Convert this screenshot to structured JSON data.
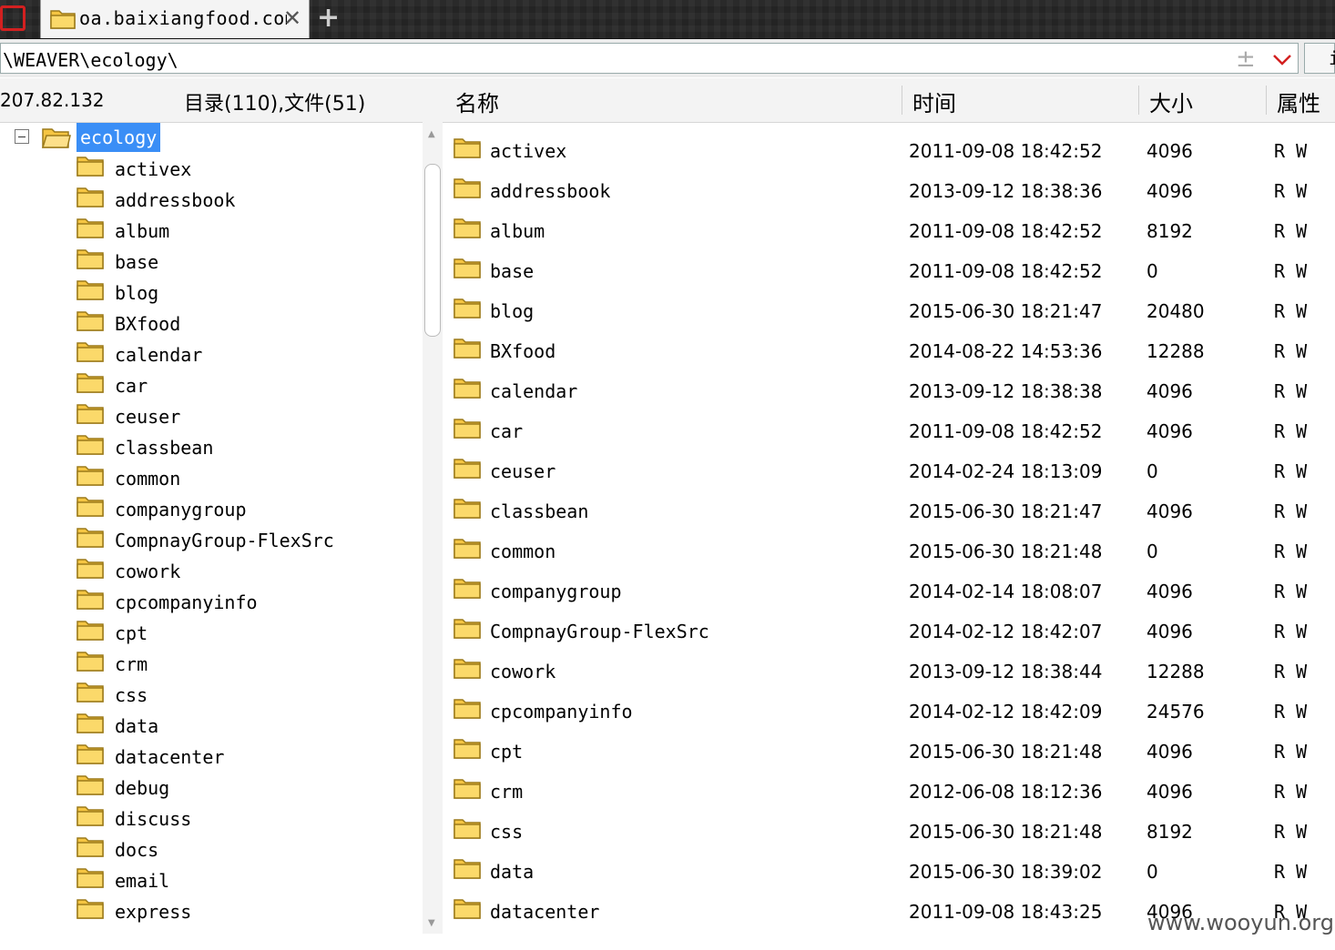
{
  "tab": {
    "title": "oa.baixiangfood.com"
  },
  "address": {
    "path": "\\WEAVER\\ecology\\",
    "go_label": "i"
  },
  "header": {
    "ip": "207.82.132",
    "counts": "目录(110),文件(51)",
    "columns": {
      "name": "名称",
      "time": "时间",
      "size": "大小",
      "attr": "属性"
    }
  },
  "tree": {
    "root": "ecology",
    "items": [
      "activex",
      "addressbook",
      "album",
      "base",
      "blog",
      "BXfood",
      "calendar",
      "car",
      "ceuser",
      "classbean",
      "common",
      "companygroup",
      "CompnayGroup-FlexSrc",
      "cowork",
      "cpcompanyinfo",
      "cpt",
      "crm",
      "css",
      "data",
      "datacenter",
      "debug",
      "discuss",
      "docs",
      "email",
      "express"
    ]
  },
  "files": [
    {
      "name": "activex",
      "time": "2011-09-08 18:42:52",
      "size": "4096",
      "attr": "R W"
    },
    {
      "name": "addressbook",
      "time": "2013-09-12 18:38:36",
      "size": "4096",
      "attr": "R W"
    },
    {
      "name": "album",
      "time": "2011-09-08 18:42:52",
      "size": "8192",
      "attr": "R W"
    },
    {
      "name": "base",
      "time": "2011-09-08 18:42:52",
      "size": "0",
      "attr": "R W"
    },
    {
      "name": "blog",
      "time": "2015-06-30 18:21:47",
      "size": "20480",
      "attr": "R W"
    },
    {
      "name": "BXfood",
      "time": "2014-08-22 14:53:36",
      "size": "12288",
      "attr": "R W"
    },
    {
      "name": "calendar",
      "time": "2013-09-12 18:38:38",
      "size": "4096",
      "attr": "R W"
    },
    {
      "name": "car",
      "time": "2011-09-08 18:42:52",
      "size": "4096",
      "attr": "R W"
    },
    {
      "name": "ceuser",
      "time": "2014-02-24 18:13:09",
      "size": "0",
      "attr": "R W"
    },
    {
      "name": "classbean",
      "time": "2015-06-30 18:21:47",
      "size": "4096",
      "attr": "R W"
    },
    {
      "name": "common",
      "time": "2015-06-30 18:21:48",
      "size": "0",
      "attr": "R W"
    },
    {
      "name": "companygroup",
      "time": "2014-02-14 18:08:07",
      "size": "4096",
      "attr": "R W"
    },
    {
      "name": "CompnayGroup-FlexSrc",
      "time": "2014-02-12 18:42:07",
      "size": "4096",
      "attr": "R W"
    },
    {
      "name": "cowork",
      "time": "2013-09-12 18:38:44",
      "size": "12288",
      "attr": "R W"
    },
    {
      "name": "cpcompanyinfo",
      "time": "2014-02-12 18:42:09",
      "size": "24576",
      "attr": "R W"
    },
    {
      "name": "cpt",
      "time": "2015-06-30 18:21:48",
      "size": "4096",
      "attr": "R W"
    },
    {
      "name": "crm",
      "time": "2012-06-08 18:12:36",
      "size": "4096",
      "attr": "R W"
    },
    {
      "name": "css",
      "time": "2015-06-30 18:21:48",
      "size": "8192",
      "attr": "R W"
    },
    {
      "name": "data",
      "time": "2015-06-30 18:39:02",
      "size": "0",
      "attr": "R W"
    },
    {
      "name": "datacenter",
      "time": "2011-09-08 18:43:25",
      "size": "4096",
      "attr": "R W"
    }
  ],
  "watermark": "www.wooyun.org",
  "colors": {
    "selection": "#3a8ef6",
    "folder": "#f5c542",
    "accent_red": "#d32020"
  }
}
